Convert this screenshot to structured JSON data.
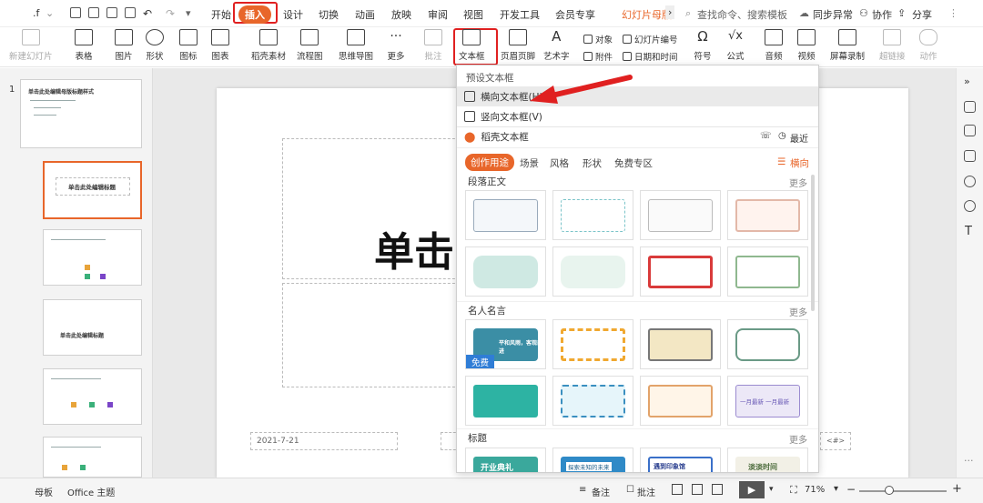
{
  "menubar": {
    "left_fragment": ".f",
    "tabs": [
      "开始",
      "插入",
      "设计",
      "切换",
      "动画",
      "放映",
      "审阅",
      "视图",
      "开发工具",
      "会员专享"
    ],
    "active_tab": "插入",
    "doc_tab": "幻灯片母版",
    "search_placeholder": "查找命令、搜索模板",
    "sync": "同步异常",
    "collab": "协作",
    "share": "分享"
  },
  "ribbon": {
    "new_slide": "新建幻灯片",
    "table": "表格",
    "picture": "图片",
    "shape": "形状",
    "icon": "图标",
    "chart": "图表",
    "material": "稻壳素材",
    "flowchart": "流程图",
    "mindmap": "思维导图",
    "more": "更多",
    "comment": "批注",
    "textbox": "文本框",
    "header_footer": "页眉页脚",
    "wordart": "艺术字",
    "object": "对象",
    "attachment": "附件",
    "slide_number": "幻灯片编号",
    "datetime": "日期和时间",
    "symbol": "符号",
    "formula": "公式",
    "audio": "音频",
    "video": "视频",
    "screen_record": "屏幕录制",
    "hyperlink": "超链接",
    "action": "动作"
  },
  "dropdown": {
    "preset_header": "预设文本框",
    "horizontal": "横向文本框(H)",
    "vertical": "竖向文本框(V)",
    "docer_header": "稻壳文本框",
    "recent": "最近",
    "tags": [
      "创作用途",
      "场景",
      "风格",
      "形状",
      "免费专区"
    ],
    "orientation": "横向",
    "sections": [
      {
        "title": "段落正文",
        "more": "更多"
      },
      {
        "title": "名人名言",
        "more": "更多"
      },
      {
        "title": "标题",
        "more": "更多"
      }
    ],
    "free_badge": "免费",
    "card_texts": [
      "开业典礼",
      "探索未知的未来",
      "遇到印象馆",
      "淡淡时间",
      "一月最新 一月最新",
      "平和风雨，客观前进"
    ]
  },
  "slides": {
    "numbers": [
      "1"
    ],
    "thumb1_title": "单击此处编辑母版标题样式",
    "thumb2_title": "单击此处编辑标题",
    "thumb4_title": "单击此处编辑标题"
  },
  "canvas": {
    "title_partial": "单击",
    "date": "2021-7-21",
    "num_placeholder": "<#>"
  },
  "statusbar": {
    "left": "母板",
    "theme": "Office 主题",
    "notes": "备注",
    "comment": "批注",
    "zoom": "71%"
  },
  "colors": {
    "accent": "#e8662a",
    "highlight_red": "#e02020",
    "arrow": "#e02020"
  }
}
